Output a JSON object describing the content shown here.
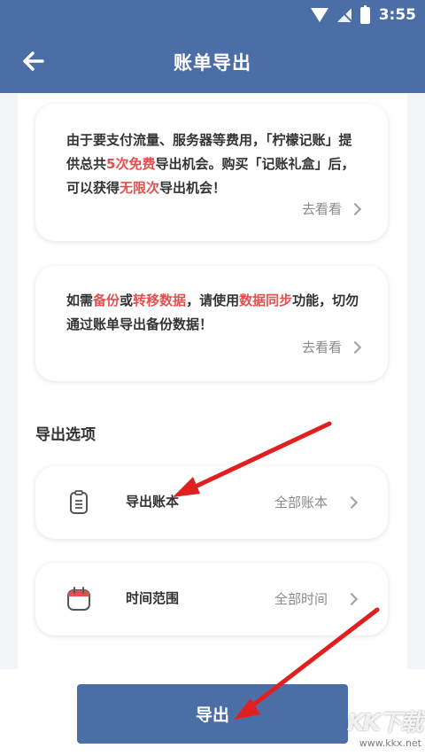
{
  "status_bar": {
    "time": "3:55"
  },
  "app_bar": {
    "title": "账单导出"
  },
  "info_card_1": {
    "text_parts": [
      {
        "text": "由于要支付流量、服务器等费用，「柠檬记账」提供总共",
        "highlight": false
      },
      {
        "text": "5次免费",
        "highlight": true
      },
      {
        "text": "导出机会。购买「记账礼盒」后，可以获得",
        "highlight": false
      },
      {
        "text": "无限次",
        "highlight": true
      },
      {
        "text": "导出机会！",
        "highlight": false
      }
    ],
    "link_label": "去看看"
  },
  "info_card_2": {
    "text_parts": [
      {
        "text": "如需",
        "highlight": false
      },
      {
        "text": "备份",
        "highlight": true
      },
      {
        "text": "或",
        "highlight": false
      },
      {
        "text": "转移数据",
        "highlight": true
      },
      {
        "text": "，请使用",
        "highlight": false
      },
      {
        "text": "数据同步",
        "highlight": true
      },
      {
        "text": "功能，切勿通过账单导出备份数据！",
        "highlight": false
      }
    ],
    "link_label": "去看看"
  },
  "export_options": {
    "title": "导出选项",
    "items": [
      {
        "label": "导出账本",
        "value": "全部账本",
        "icon": "ledger-icon"
      },
      {
        "label": "时间范围",
        "value": "全部时间",
        "icon": "calendar-icon"
      }
    ]
  },
  "export_button": {
    "label": "导出"
  },
  "watermark": {
    "logo": "KK下载",
    "url": "www.kkx.net"
  },
  "colors": {
    "primary": "#4b6ea7",
    "highlight": "#e0524f",
    "annotation_arrow": "#e02020"
  }
}
